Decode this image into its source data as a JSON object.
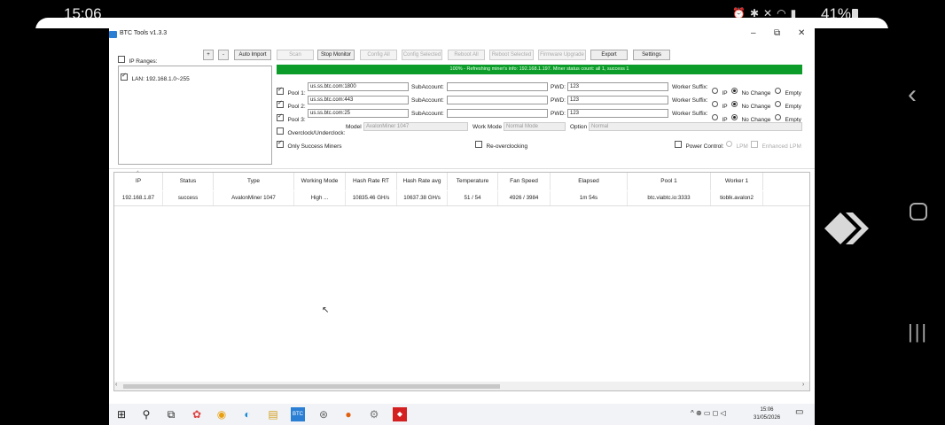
{
  "android": {
    "time": "15:06",
    "battery": "41%",
    "status_icons": [
      "alarm-icon",
      "bluetooth-icon",
      "mute-icon",
      "wifi-icon",
      "signal-icon",
      "battery-icon"
    ]
  },
  "window": {
    "title": "BTC Tools v1.3.3",
    "controls": {
      "minimize": "–",
      "maximize": "⧉",
      "close": "✕"
    }
  },
  "toolbar": {
    "ip_ranges_label": "IP Ranges:",
    "plus": "+",
    "minus": "-",
    "auto_import": "Auto Import",
    "scan": "Scan",
    "stop_monitor": "Stop Monitor",
    "config_all": "Config All",
    "config_selected": "Config Selected",
    "reboot_all": "Reboot All",
    "reboot_selected": "Reboot Selected",
    "firmware_upgrade": "Firmware Upgrade",
    "export": "Export",
    "settings": "Settings"
  },
  "lan_item": "LAN: 192.168.1.0~255",
  "progress_text": "100% - Refreshing miner's info: 192.168.1.197. Miner status count: all 1, success 1",
  "pools": [
    {
      "label": "Pool 1:",
      "url": "us.ss.btc.com:1800",
      "subaccount_label": "SubAccount:",
      "subaccount": "",
      "pwd_label": "PWD:",
      "pwd": "123",
      "worker_suffix_label": "Worker Suffix:"
    },
    {
      "label": "Pool 2:",
      "url": "us.ss.btc.com:443",
      "subaccount_label": "SubAccount:",
      "subaccount": "",
      "pwd_label": "PWD:",
      "pwd": "123",
      "worker_suffix_label": "Worker Suffix:"
    },
    {
      "label": "Pool 3:",
      "url": "us.ss.btc.com:25",
      "subaccount_label": "SubAccount:",
      "subaccount": "",
      "pwd_label": "PWD:",
      "pwd": "123",
      "worker_suffix_label": "Worker Suffix:"
    }
  ],
  "suffix_options": {
    "ip": "IP",
    "no_change": "No Change",
    "empty": "Empty"
  },
  "overclock": {
    "label": "Overclock/Underclock:",
    "model_label": "Model",
    "model_value": "AvalonMiner 1047",
    "work_mode_label": "Work Mode",
    "work_mode_value": "Normal Mode",
    "option_label": "Option",
    "option_value": "Normal"
  },
  "only_success_label": "Only Success Miners",
  "reoverclocking_label": "Re-overclocking",
  "power_control_label": "Power Control:",
  "lpm_label": "LPM",
  "enhanced_lpm_label": "Enhanced LPM",
  "table": {
    "columns": [
      "IP",
      "Status",
      "Type",
      "Working Mode",
      "Hash Rate RT",
      "Hash Rate avg",
      "Temperature",
      "Fan Speed",
      "Elapsed",
      "Pool 1",
      "Worker 1"
    ],
    "rows": [
      [
        "192.168.1.87",
        "success",
        "AvalonMiner 1047",
        "High ...",
        "10835.46 GH/s",
        "10637.38 GH/s",
        "51 / 54",
        "4926 / 3984",
        "1m 54s",
        "btc.viabtc.io:3333",
        "tioblk.avalon2"
      ]
    ]
  },
  "taskbar": {
    "clock_time": "15:06",
    "clock_date": "31/05/2026"
  }
}
